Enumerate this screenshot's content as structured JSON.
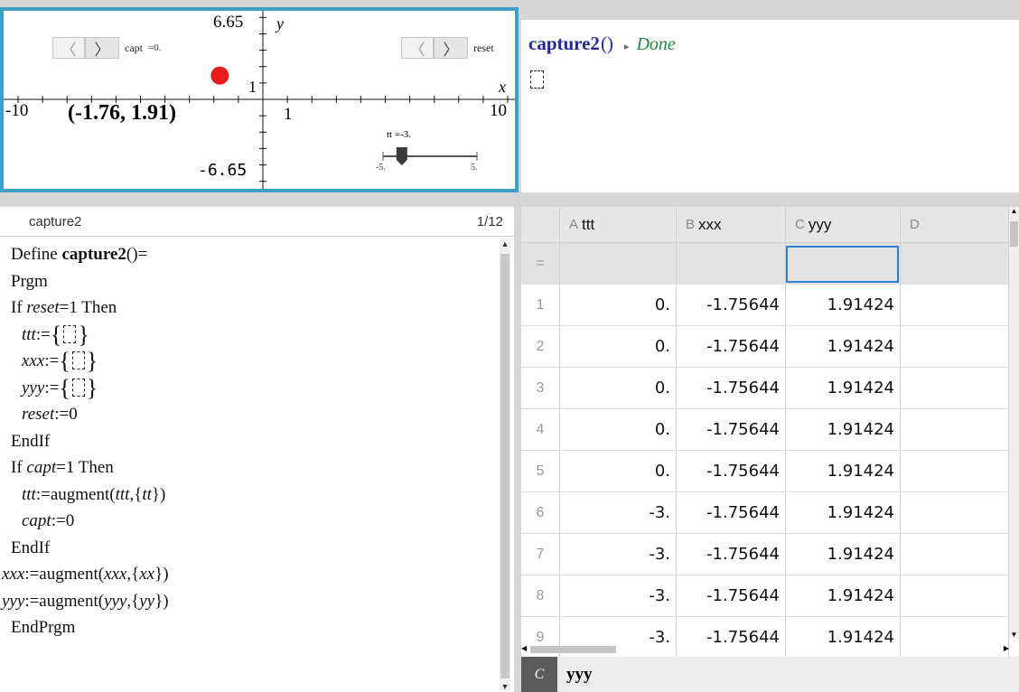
{
  "graph": {
    "y_max_label": "6.65",
    "y_min_label": "-6.65",
    "x_min_label": "-10",
    "x_max_label": "10",
    "x_one_label": "1",
    "y_one_label": "1",
    "x_axis_name": "x",
    "y_axis_name": "y",
    "point_label": "(-1.76, 1.91)",
    "point_color": "#e81a1a",
    "capt": {
      "label": "capt",
      "value": "=0."
    },
    "reset": {
      "label": "reset"
    },
    "slider": {
      "label": "tt",
      "value": "=-3.",
      "min_label": "-5.",
      "max_label": "5.",
      "fraction": 0.2
    }
  },
  "calc": {
    "command": "capture2",
    "paren": "()",
    "result": "Done"
  },
  "editor": {
    "name": "capture2",
    "position": "1/12",
    "lines": {
      "l1a": "Define ",
      "l1b": "capture2",
      "l1c": "()=",
      "l2": "Prgm",
      "l3a": "If ",
      "l3b": "reset",
      "l3c": "=1 Then",
      "l4a": "ttt",
      "l4b": ":=",
      "l5a": "xxx",
      "l5b": ":=",
      "l6a": "yyy",
      "l6b": ":=",
      "l7a": "reset",
      "l7b": ":=0",
      "l8": "EndIf",
      "l9a": "If ",
      "l9b": "capt",
      "l9c": "=1 Then",
      "l10a": "ttt",
      "l10b": ":=augment(",
      "l10c": "ttt",
      "l10d": ",{",
      "l10e": "tt",
      "l10f": "})",
      "l11a": "capt",
      "l11b": ":=0",
      "l12": "EndIf",
      "l13a": "xxx",
      "l13b": ":=augment(",
      "l13c": "xxx",
      "l13d": ",{",
      "l13e": "xx",
      "l13f": "})",
      "l14a": "yyy",
      "l14b": ":=augment(",
      "l14c": "yyy",
      "l14d": ",{",
      "l14e": "yy",
      "l14f": "})",
      "l15": "EndPrgm"
    }
  },
  "sheet": {
    "columns": [
      {
        "letter": "A",
        "name": "ttt"
      },
      {
        "letter": "B",
        "name": "xxx"
      },
      {
        "letter": "C",
        "name": "yyy"
      },
      {
        "letter": "D",
        "name": ""
      }
    ],
    "formula_marker": "=",
    "rows": [
      {
        "n": "1",
        "a": "0.",
        "b": "-1.75644",
        "c": "1.91424"
      },
      {
        "n": "2",
        "a": "0.",
        "b": "-1.75644",
        "c": "1.91424"
      },
      {
        "n": "3",
        "a": "0.",
        "b": "-1.75644",
        "c": "1.91424"
      },
      {
        "n": "4",
        "a": "0.",
        "b": "-1.75644",
        "c": "1.91424"
      },
      {
        "n": "5",
        "a": "0.",
        "b": "-1.75644",
        "c": "1.91424"
      },
      {
        "n": "6",
        "a": "-3.",
        "b": "-1.75644",
        "c": "1.91424"
      },
      {
        "n": "7",
        "a": "-3.",
        "b": "-1.75644",
        "c": "1.91424"
      },
      {
        "n": "8",
        "a": "-3.",
        "b": "-1.75644",
        "c": "1.91424"
      },
      {
        "n": "9",
        "a": "-3.",
        "b": "-1.75644",
        "c": "1.91424"
      }
    ],
    "footer_letter": "C",
    "footer_value": "yyy",
    "selection_color": "#2e7fd3"
  }
}
